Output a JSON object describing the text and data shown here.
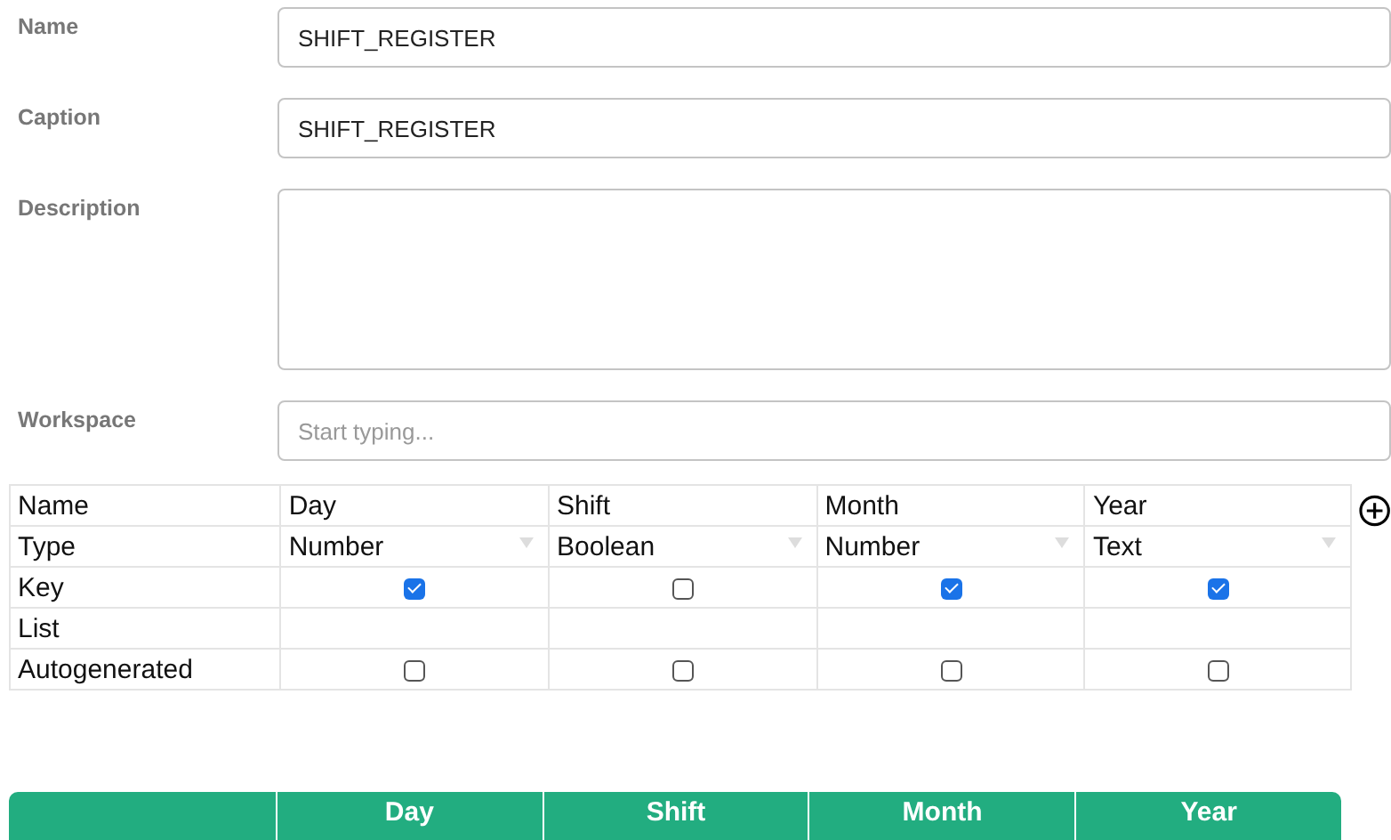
{
  "form": [
    {
      "label": "Name",
      "kind": "input",
      "value": "SHIFT_REGISTER"
    },
    {
      "label": "Caption",
      "kind": "input",
      "value": "SHIFT_REGISTER"
    },
    {
      "label": "Description",
      "kind": "textarea"
    },
    {
      "label": "Workspace",
      "kind": "input",
      "placeholder": "Start typing..."
    }
  ],
  "fields_table": {
    "row_labels": [
      "Name",
      "Type",
      "Key",
      "List",
      "Autogenerated"
    ],
    "columns": [
      {
        "name": "Day",
        "type": "Number",
        "key": true,
        "autogenerated": false
      },
      {
        "name": "Shift",
        "type": "Boolean",
        "key": false,
        "autogenerated": false
      },
      {
        "name": "Month",
        "type": "Number",
        "key": true,
        "autogenerated": false
      },
      {
        "name": "Year",
        "type": "Text",
        "key": true,
        "autogenerated": false
      }
    ]
  },
  "preview_table": {
    "columns": [
      "Day",
      "Shift",
      "Month",
      "Year"
    ]
  }
}
